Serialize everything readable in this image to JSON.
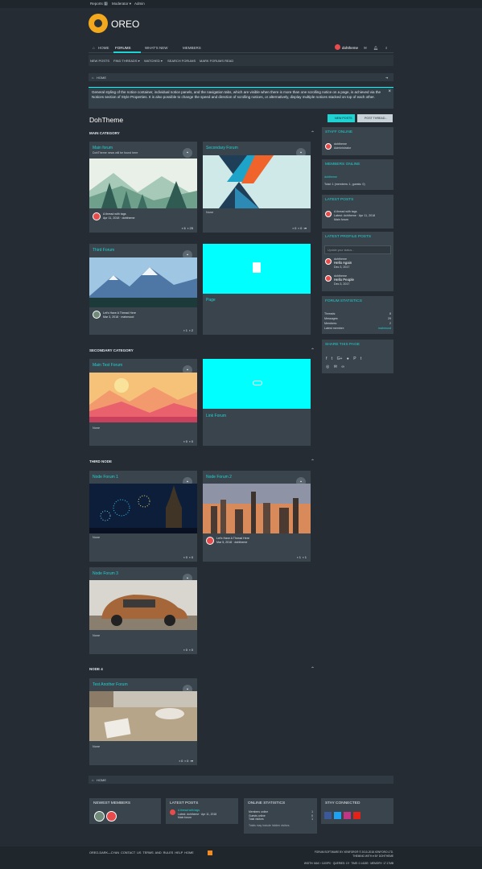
{
  "topbar": {
    "reports": "Reports",
    "reports_count": "1",
    "moderator": "Moderator ▾",
    "admin": "Admin"
  },
  "logo": {
    "text": "OREO"
  },
  "nav": {
    "home": "HOME",
    "forums": "FORUMS",
    "whats_new": "WHAT'S NEW",
    "members": "MEMBERS",
    "user": "dohtheme"
  },
  "subnav": {
    "items": [
      "NEW POSTS",
      "FIND THREADS ▾",
      "WATCHED ▾",
      "SEARCH FORUMS",
      "MARK FORUMS READ"
    ]
  },
  "breadcrumb": {
    "home": "HOME"
  },
  "notice": {
    "text": "General styling of the notice container, individual notice panels, and the navigation tabs, which are visible when there is more than one scrolling notice on a page, is achieved via the Notices section of Style Properties. It is also possible to change the speed and direction of scrolling notices, or alternatively, display multiple notices stacked on top of each other."
  },
  "page": {
    "title": "DohTheme",
    "new_posts": "NEW POSTS",
    "post_thread": "POST THREAD..."
  },
  "categories": {
    "main": "MAIN CATEGORY",
    "secondary": "SECONDARY CATEGORY",
    "third": "THIRD NODE",
    "node4": "NODE 4"
  },
  "forums": {
    "main": {
      "title": "Main forum",
      "desc": "DohTheme news will be found here",
      "thread": "A thread with tags",
      "meta": "Apr 11, 2018 · dohtheme",
      "msgs": "6",
      "posts": "25"
    },
    "secondary": {
      "title": "Secondary Forum",
      "none": "None",
      "msgs": "0",
      "posts": "0"
    },
    "third": {
      "title": "Third Forum",
      "thread": "Let's Have A Thread Here",
      "meta": "Mar 3, 2018 · mahmood",
      "msgs": "1",
      "posts": "2"
    },
    "page": {
      "title": "Page"
    },
    "main_test": {
      "title": "Main Test Forum",
      "none": "None",
      "msgs": "0",
      "posts": "0"
    },
    "link": {
      "title": "Link Forum"
    },
    "node1": {
      "title": "Node Forum 1",
      "none": "None",
      "msgs": "0",
      "posts": "0"
    },
    "node2": {
      "title": "Node Forum 2",
      "thread": "Let's Have A Thread Here",
      "meta": "Mar 5, 2018 · dohtheme",
      "msgs": "1",
      "posts": "1"
    },
    "node3": {
      "title": "Node Forum 3",
      "none": "None",
      "msgs": "0",
      "posts": "0"
    },
    "test_another": {
      "title": "Test Another Forum",
      "none": "None",
      "msgs": "0",
      "posts": "0"
    }
  },
  "sidebar": {
    "staff": {
      "title": "STAFF ONLINE",
      "name": "dohtheme",
      "role": "Administrator"
    },
    "members": {
      "title": "MEMBERS ONLINE",
      "name": "dohtheme",
      "total": "Total: 1 (members: 1, guests: 0)"
    },
    "latest_posts": {
      "title": "LATEST POSTS",
      "thread": "A thread with tags",
      "meta": "Latest: dohtheme · Apr 11, 2018",
      "forum": "Main forum"
    },
    "profile_posts": {
      "title": "LATEST PROFILE POSTS",
      "placeholder": "Update your status...",
      "p1_user": "dohtheme",
      "p1_text": "Hello Again",
      "p1_date": "Dec 3, 2017",
      "p2_user": "dohtheme",
      "p2_text": "Hello People",
      "p2_date": "Dec 3, 2017"
    },
    "stats": {
      "title": "FORUM STATISTICS",
      "threads_l": "Threads:",
      "threads_v": "8",
      "messages_l": "Messages:",
      "messages_v": "29",
      "members_l": "Members:",
      "members_v": "2",
      "latest_l": "Latest member:",
      "latest_v": "mahmood"
    },
    "share": {
      "title": "SHARE THIS PAGE"
    }
  },
  "footer": {
    "newest": "NEWEST MEMBERS",
    "latest": "LATEST POSTS",
    "lp_thread": "A thread with tags",
    "lp_meta": "Latest: dohtheme · Apr 11, 2018",
    "lp_forum": "Main forum",
    "online": "ONLINE STATISTICS",
    "mo_l": "Members online",
    "mo_v": "1",
    "go_l": "Guests online",
    "go_v": "0",
    "tv_l": "Total visitors",
    "tv_v": "1",
    "note": "Totals may include hidden visitors.",
    "connected": "STAY CONNECTED",
    "links": "OREO-DARK—CYAN   CONTACT US   TERMS AND RULES   HELP   HOME",
    "copyright": "FORUM SOFTWARE BY XENFORO® © 2010-2018 XENFORO LTD.",
    "theming": "THEMING WITH ♥ BY DOHTHEME",
    "debug": "WIDTH: MAX › 1100PX · QUERIES: 19 · TIME: 0.1418S · MEMORY: 17.17MB"
  }
}
